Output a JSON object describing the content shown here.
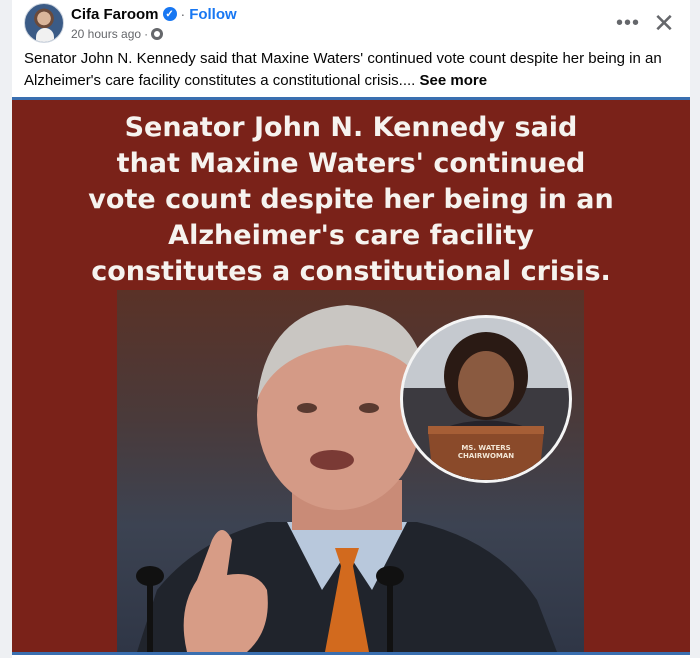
{
  "post": {
    "author": "Cifa Faroom",
    "follow_label": "Follow",
    "separator": "·",
    "timestamp": "20 hours ago",
    "meta_separator": "·",
    "more_icon": "more-horizontal-icon",
    "close_icon": "close-icon",
    "caption_text": "Senator John N. Kennedy said that Maxine Waters' continued vote count despite her being in an Alzheimer's care facility constitutes a constitutional crisis....",
    "see_more_label": "See more"
  },
  "image": {
    "headline_lines": [
      "Senator John N. Kennedy said",
      "that Maxine Waters' continued",
      "vote count despite her being in an",
      "Alzheimer's care facility",
      "constitutes a constitutional crisis."
    ],
    "podium_label_line1": "MS. WATERS",
    "podium_label_line2": "CHAIRWOMAN"
  },
  "colors": {
    "image_background": "#7a2219",
    "link_blue": "#1877f2",
    "separator_blue": "#3a6fb0"
  }
}
